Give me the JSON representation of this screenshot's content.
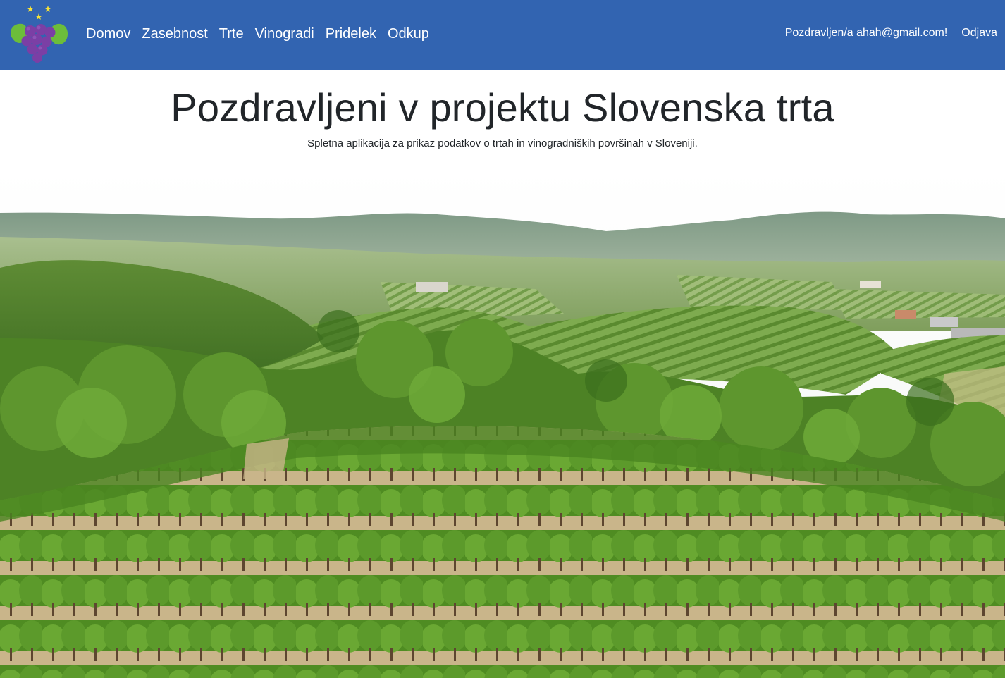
{
  "navbar": {
    "links": [
      "Domov",
      "Zasebnost",
      "Trte",
      "Vinogradi",
      "Pridelek",
      "Odkup"
    ],
    "greeting": "Pozdravljen/a ahah@gmail.com!",
    "logout_label": "Odjava",
    "logo_icon": "grapes-logo-icon"
  },
  "main": {
    "title": "Pozdravljeni v projektu Slovenska trta",
    "subtitle": "Spletna aplikacija za prikaz podatkov o trtah in vinogradniških površinah v Sloveniji."
  },
  "colors": {
    "navbar_bg": "#3264b1",
    "text": "#212529",
    "grape": "#7b3fa5",
    "leaf": "#6cbd3a",
    "star": "#f5e23a"
  }
}
